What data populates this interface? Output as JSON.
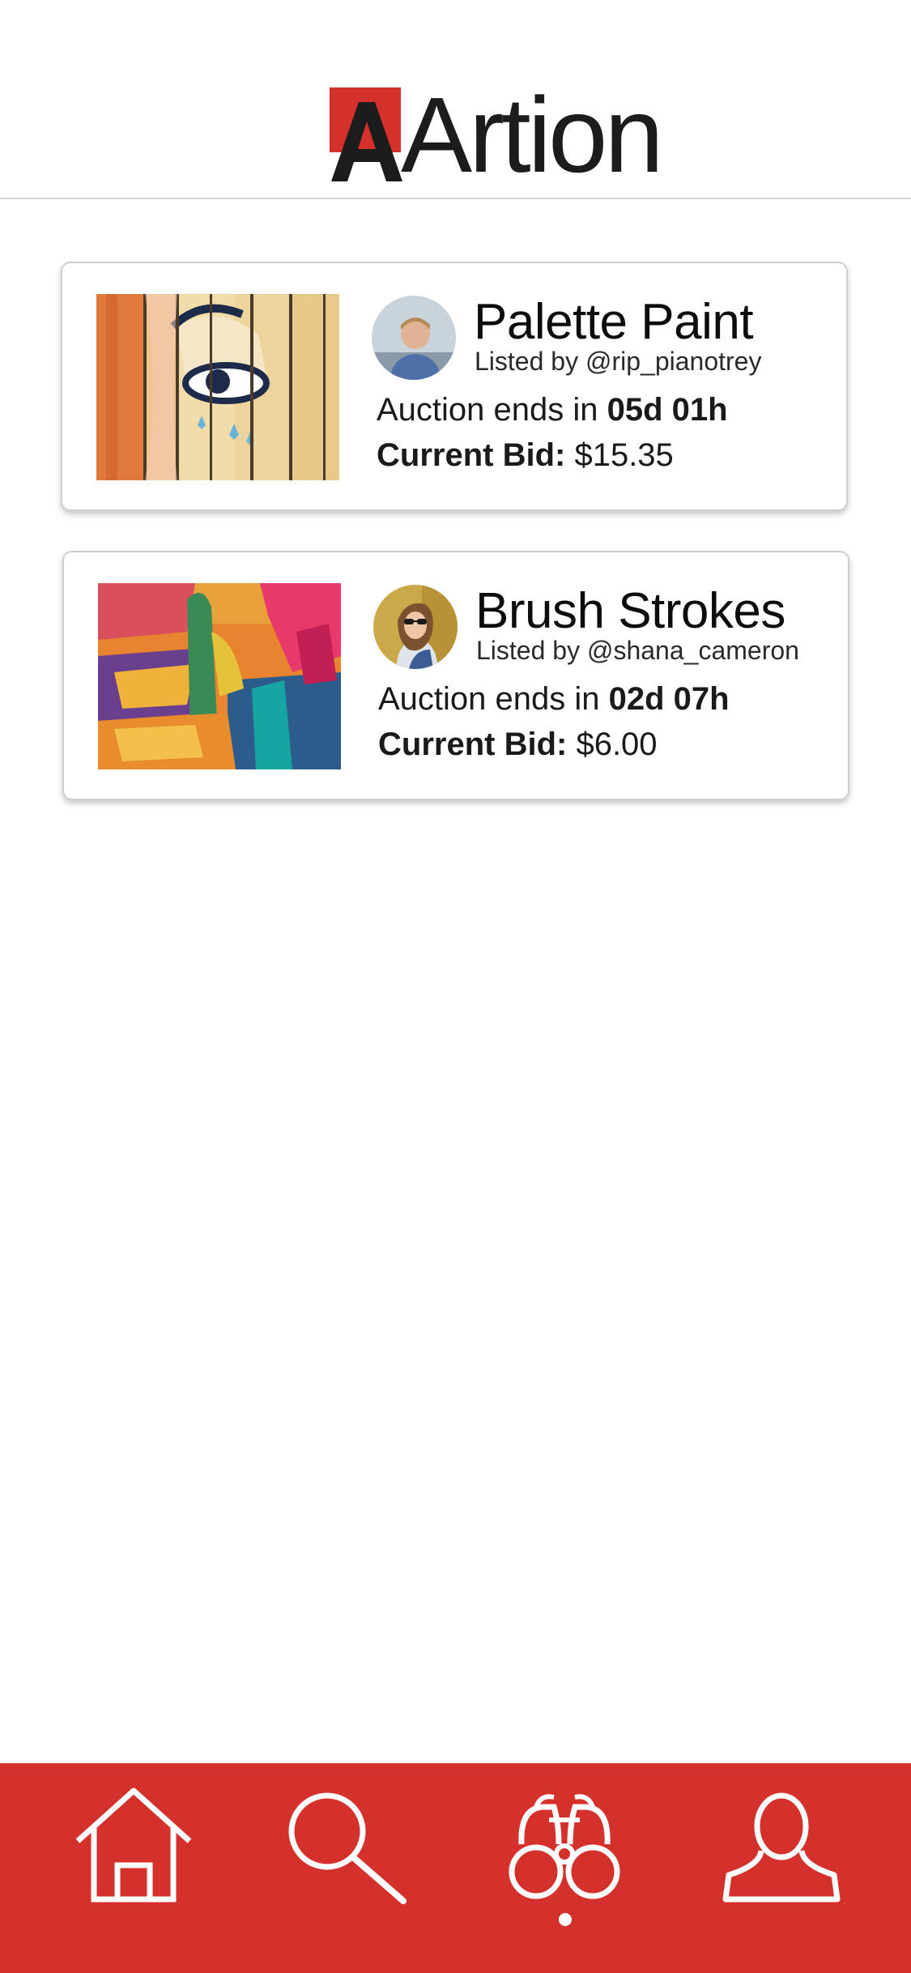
{
  "app": {
    "name": "Artion",
    "brand_color": "#d4302c"
  },
  "listings": [
    {
      "title": "Palette Paint",
      "listed_by_prefix": "Listed by ",
      "seller": "@rip_pianotrey",
      "auction_prefix": "Auction ends in ",
      "auction_remaining": "05d 01h",
      "bid_label": "Current Bid:",
      "bid_value": "$15.35"
    },
    {
      "title": "Brush Strokes",
      "listed_by_prefix": "Listed by ",
      "seller": "@shana_cameron",
      "auction_prefix": "Auction ends in ",
      "auction_remaining": "02d 07h",
      "bid_label": "Current Bid:",
      "bid_value": "$6.00"
    }
  ],
  "nav": {
    "items": [
      {
        "icon": "home-icon"
      },
      {
        "icon": "search-icon"
      },
      {
        "icon": "binoculars-icon",
        "active": true
      },
      {
        "icon": "profile-icon"
      }
    ]
  }
}
